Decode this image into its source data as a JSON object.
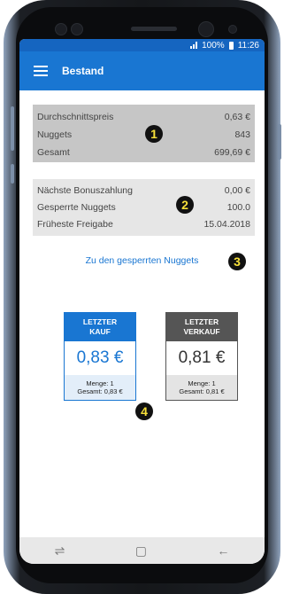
{
  "statusbar": {
    "battery": "100%",
    "time": "11:26"
  },
  "appbar": {
    "title": "Bestand"
  },
  "summary": {
    "avg_label": "Durchschnittspreis",
    "avg_value": "0,63 €",
    "nuggets_label": "Nuggets",
    "nuggets_value": "843",
    "total_label": "Gesamt",
    "total_value": "699,69 €"
  },
  "bonus": {
    "next_label": "Nächste Bonuszahlung",
    "next_value": "0,00 €",
    "locked_label": "Gesperrte Nuggets",
    "locked_value": "100.0",
    "release_label": "Früheste Freigabe",
    "release_value": "15.04.2018",
    "link_label": "Zu den gesperrten Nuggets"
  },
  "badges": {
    "b1": "1",
    "b2": "2",
    "b3": "3",
    "b4": "4"
  },
  "cards": {
    "buy": {
      "head1": "LETZTER",
      "head2": "KAUF",
      "price": "0,83 €",
      "qty": "Menge: 1",
      "total": "Gesamt: 0,83 €"
    },
    "sell": {
      "head1": "LETZTER",
      "head2": "VERKAUF",
      "price": "0,81 €",
      "qty": "Menge: 1",
      "total": "Gesamt: 0,81 €"
    }
  },
  "colors": {
    "primary": "#1976d2",
    "dark_card": "#555555",
    "panel_grey": "#c6c6c6",
    "panel_light": "#e6e6e6",
    "badge_text": "#f7e03a"
  },
  "icons": {
    "menu": "hamburger-icon",
    "recent": "recent-apps-icon",
    "home": "home-icon",
    "back": "back-arrow-icon"
  }
}
